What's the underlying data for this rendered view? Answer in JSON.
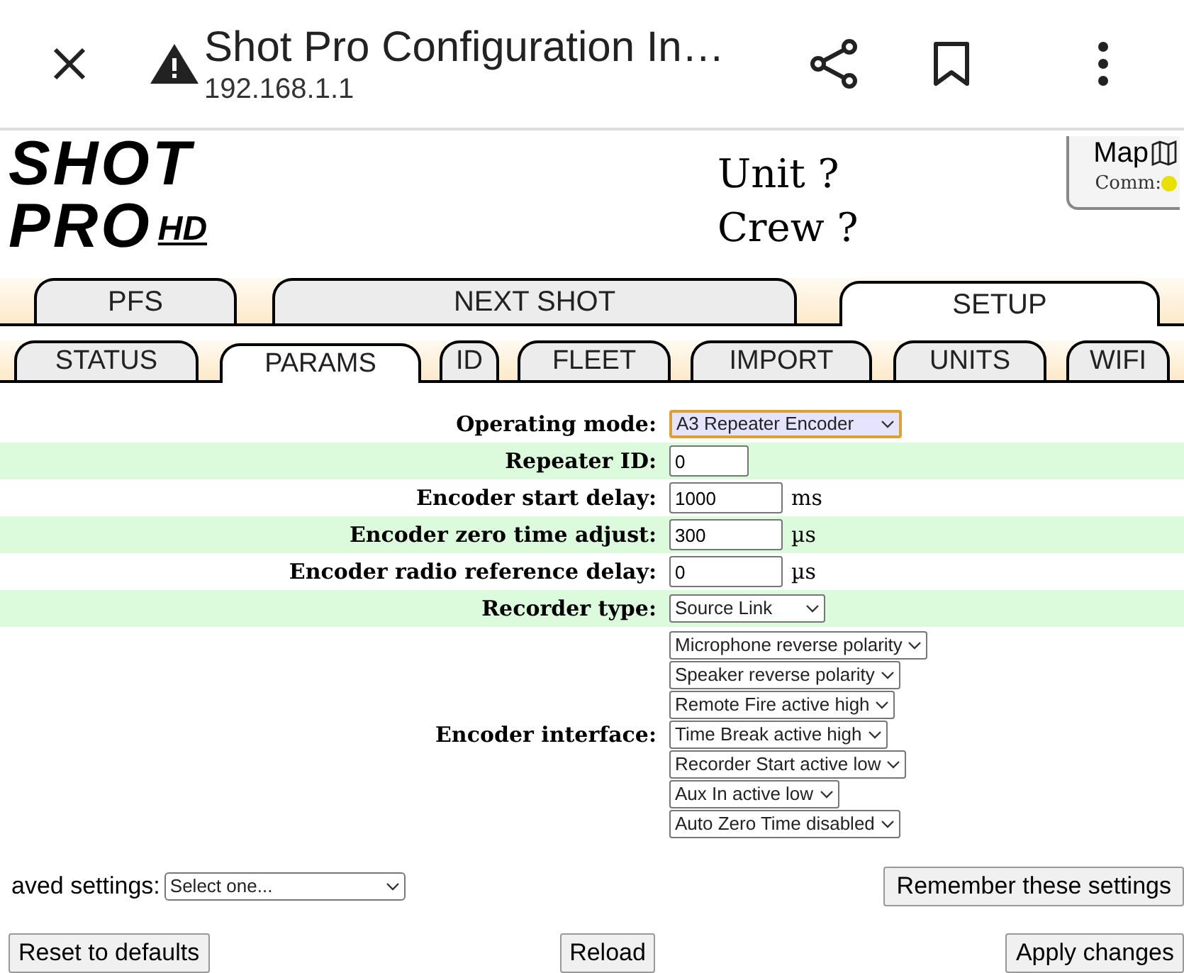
{
  "browser_bar": {
    "title": "Shot Pro Configuration In…",
    "url": "192.168.1.1"
  },
  "header": {
    "logo": {
      "line_1": "SHOT",
      "line_2": "PRO",
      "badge": "HD"
    },
    "unit": "Unit ?",
    "crew": "Crew ?",
    "map_button": {
      "label": "Map",
      "comm_label": "Comm:",
      "comm_dot": {
        "color": "#e8e000"
      }
    }
  },
  "main_tabs": [
    {
      "label": "PFS",
      "selected": false
    },
    {
      "label": "NEXT SHOT",
      "selected": false
    },
    {
      "label": "SETUP",
      "selected": true
    }
  ],
  "sub_tabs": [
    {
      "label": "STATUS",
      "selected": false
    },
    {
      "label": "PARAMS",
      "selected": true
    },
    {
      "label": "ID",
      "selected": false
    },
    {
      "label": "FLEET",
      "selected": false
    },
    {
      "label": "IMPORT",
      "selected": false
    },
    {
      "label": "UNITS",
      "selected": false
    },
    {
      "label": "WIFI",
      "selected": false
    }
  ],
  "form_rows": [
    {
      "kind": "select",
      "label": "Operating mode:",
      "value": "A3 Repeater Encoder",
      "focused": true
    },
    {
      "kind": "input",
      "label": "Repeater ID:",
      "value": "0"
    },
    {
      "kind": "input",
      "label": "Encoder start delay:",
      "value": "1000",
      "unit": "ms"
    },
    {
      "kind": "input",
      "label": "Encoder zero time adjust:",
      "value": "300",
      "unit": "µs"
    },
    {
      "kind": "input",
      "label": "Encoder radio reference delay:",
      "value": "0",
      "unit": "µs"
    },
    {
      "kind": "select",
      "label": "Recorder type:",
      "value": "Source Link",
      "focused": false
    },
    {
      "kind": "selects",
      "label": "Encoder interface:",
      "values": [
        "Microphone reverse polarity",
        "Speaker reverse polarity",
        "Remote Fire active high",
        "Time Break active high",
        "Recorder Start active low",
        "Aux In active low",
        "Auto Zero Time disabled"
      ]
    }
  ],
  "saved_settings": {
    "label": "aved settings:",
    "value": "Select one...",
    "button": "Remember these settings"
  },
  "buttons": [
    "Reset to defaults",
    "Reload",
    "Apply changes"
  ]
}
